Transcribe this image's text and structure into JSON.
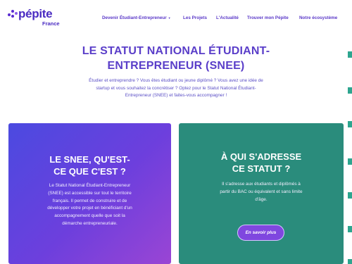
{
  "brand": {
    "name": "pépite",
    "subtitle": "France",
    "colors": {
      "primary": "#5a38c8",
      "teal": "#2a8c7c",
      "purple": "#7f47df"
    }
  },
  "nav": {
    "items": [
      {
        "label": "Devenir Étudiant-Entrepreneur",
        "has_dropdown": true
      },
      {
        "label": "Les Projets"
      },
      {
        "label": "L'Actualité"
      },
      {
        "label": "Trouver mon Pépite"
      },
      {
        "label": "Notre écosystème"
      }
    ],
    "dropdown_icon": "chevron-down-icon"
  },
  "hero": {
    "title_line1": "LE STATUT NATIONAL ÉTUDIANT-",
    "title_line2": "ENTREPRENEUR (SNEE)",
    "desc_line1": "Étudier et entreprendre ? Vous êtes étudiant ou jeune diplômé ? Vous avez une idée de",
    "desc_line2": "startup et vous souhaitez la concrétiser ? Optez pour le Statut National Étudiant-",
    "desc_line3": "Entrepreneur (SNEE) et faites-vous accompagner !"
  },
  "cards": {
    "left": {
      "title_line1": "LE SNEE, QU'EST-",
      "title_line2": "CE QUE C'EST ?",
      "body_line1": "Le Statut National Étudiant-Entrepreneur",
      "body_line2": "(SNEE) est accessible sur tout le territoire",
      "body_line3": "français. Il permet de construire et de",
      "body_line4": "développer votre projet en bénéficiant d'un",
      "body_line5": "accompagnement quelle que soit la",
      "body_line6": "démarche entrepreneuriale."
    },
    "right": {
      "title_line1": "À QUI S'ADRESSE",
      "title_line2": "CE STATUT ?",
      "body_line1": "Il s'adresse aux étudiants et diplômés à",
      "body_line2": "partir du BAC ou équivalent et sans limite",
      "body_line3": "d'âge.",
      "button_label": "En savoir plus"
    }
  }
}
